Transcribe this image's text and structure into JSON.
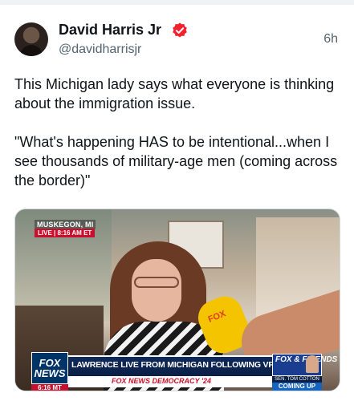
{
  "author": {
    "name": "David Harris Jr",
    "handle": "@davidharrisjr",
    "verified_badge_color": "#f4212e"
  },
  "timestamp": "6h",
  "tweet": {
    "paragraph1": "This Michigan lady says what everyone is thinking about the immigration issue.",
    "paragraph2": "\"What's happening HAS to be intentional...when I see thousands of military-age men (coming across the border)\""
  },
  "media": {
    "location": "MUSKEGON, MI",
    "live_tag": "LIVE | 8:16 AM ET",
    "mic_label": "FOX",
    "network_logo": "FOX NEWS",
    "network_time": "6:16 MT",
    "headline": "LAWRENCE LIVE FROM MICHIGAN FOLLOWING VP DEBATE",
    "ticker": "FOX NEWS DEMOCRACY '24",
    "show_logo": "FOX & FRIENDS",
    "show_sub": "SEN. TOM COTTON",
    "show_coming": "COMING UP"
  },
  "colors": {
    "text_primary": "#0f1419",
    "text_secondary": "#536471",
    "fox_red": "#c8102e",
    "fox_navy": "#0a1f45"
  }
}
